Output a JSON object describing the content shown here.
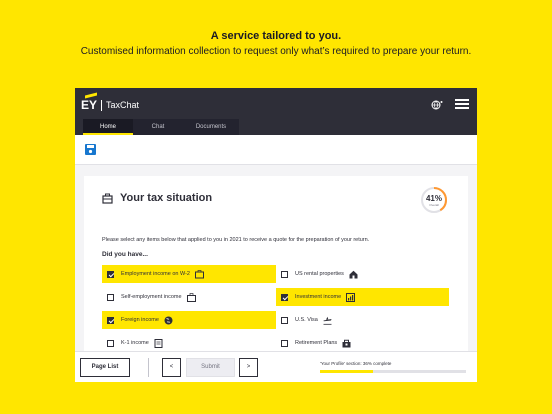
{
  "promo": {
    "title": "A service tailored to you.",
    "subtitle": "Customised information collection to request only what’s required to prepare your return."
  },
  "app": {
    "brand": "EY",
    "name": "TaxChat",
    "tabs": [
      {
        "label": "Home",
        "active": true
      },
      {
        "label": "Chat",
        "active": false
      },
      {
        "label": "Documents",
        "active": false
      }
    ],
    "icons": {
      "globe": "globe-icon",
      "menu": "hamburger-icon",
      "save": "save-icon"
    }
  },
  "section": {
    "title": "Your tax situation",
    "title_icon": "briefcase-icon",
    "progress_percent": "41%",
    "progress_label": "Overall",
    "instructions": "Please select any items below that applied to you in 2021 to receive a quote for the preparation of your return.",
    "question": "Did you have...",
    "options": [
      {
        "label": "Employment income on W-2",
        "checked": true,
        "icon": "w2-form-icon"
      },
      {
        "label": "US rental properties",
        "checked": false,
        "icon": "house-icon"
      },
      {
        "label": "Self-employment income",
        "checked": false,
        "icon": "briefcase-icon"
      },
      {
        "label": "Investment income",
        "checked": true,
        "icon": "investment-chart-icon"
      },
      {
        "label": "Foreign income",
        "checked": true,
        "icon": "world-globe-icon"
      },
      {
        "label": "U.S. Visa",
        "checked": false,
        "icon": "airplane-icon"
      },
      {
        "label": "K-1 income",
        "checked": false,
        "icon": "document-icon"
      },
      {
        "label": "Retirement Plans",
        "checked": false,
        "icon": "retirement-icon"
      }
    ]
  },
  "footer": {
    "page_list": "Page List",
    "prev": "<",
    "submit": "Submit",
    "next": ">",
    "status": "'Your Profile' section: 36% complete",
    "status_value": 0.36
  },
  "colors": {
    "accent": "#FFE600",
    "dark": "#2e2e38"
  }
}
